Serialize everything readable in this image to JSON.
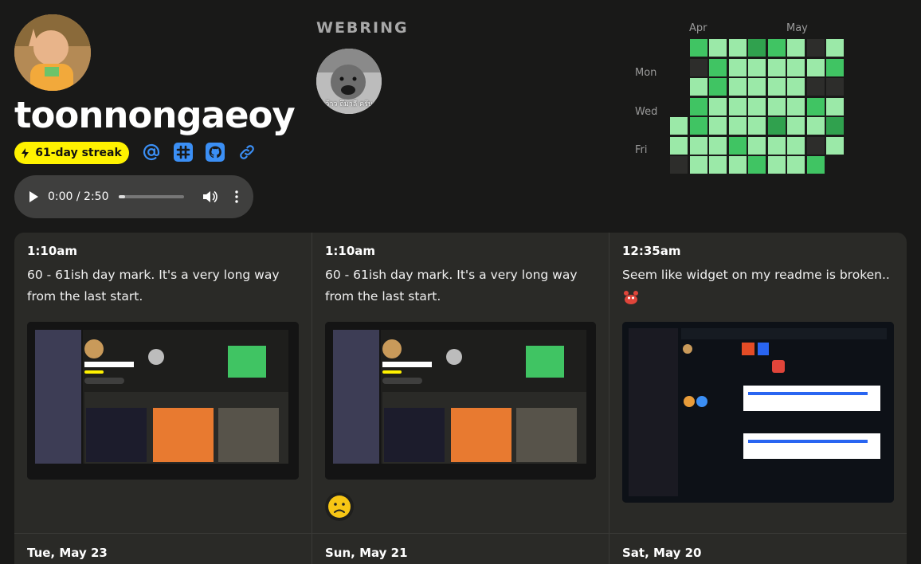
{
  "profile": {
    "username": "toonnongaeoy",
    "streak_label": "61-day streak",
    "link_icons": [
      "at-icon",
      "slack-icon",
      "github-icon",
      "link-icon"
    ]
  },
  "audio": {
    "time": "0:00 / 2:50",
    "progress": 0.1
  },
  "webring": {
    "title": "WEBRING",
    "caption": "ว้าว ถึมาลี ครับ"
  },
  "heatmap": {
    "months": [
      "Apr",
      "May"
    ],
    "days": [
      "Mon",
      "Wed",
      "Fri"
    ],
    "colors": {
      "empty": "#2d2d2b",
      "level1": "#9be9a8",
      "level2": "#40c463",
      "level3": "#30a14e",
      "level4": "#216e39"
    },
    "weeks": [
      [
        0,
        0,
        0,
        0,
        1,
        1,
        0
      ],
      [
        2,
        0,
        1,
        2,
        2,
        1,
        1
      ],
      [
        1,
        2,
        2,
        1,
        1,
        1,
        1
      ],
      [
        1,
        1,
        1,
        1,
        1,
        2,
        1
      ],
      [
        3,
        1,
        1,
        1,
        1,
        1,
        2
      ],
      [
        2,
        1,
        1,
        1,
        3,
        1,
        1
      ],
      [
        1,
        1,
        1,
        1,
        1,
        1,
        1
      ],
      [
        0,
        1,
        0,
        2,
        1,
        0,
        2
      ],
      [
        1,
        2,
        0,
        1,
        3,
        1,
        1
      ]
    ]
  },
  "posts": [
    {
      "time": "1:10am",
      "text": "60 - 61ish day mark. It's a very long way from the last start."
    },
    {
      "time": "1:10am",
      "text": "60 - 61ish day mark. It's a very long way from the last start."
    },
    {
      "time": "12:35am",
      "text": "Seem like widget on my readme is broken.."
    }
  ],
  "day_headers": [
    "Tue, May 23",
    "Sun, May 21",
    "Sat, May 20"
  ],
  "reactions": {
    "frown": "frown-emoji",
    "crab": "crab-emoji"
  }
}
